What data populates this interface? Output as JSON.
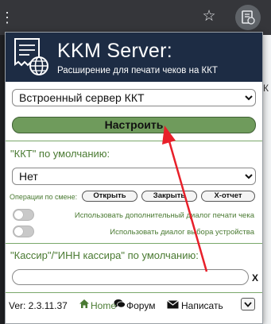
{
  "browser": {
    "bookmark_icon": "star-icon",
    "extension_icon": "kkm-extension-icon",
    "behind_text": "К"
  },
  "popup": {
    "title": "KKM Server:",
    "subtitle": "Расширение для печати чеков на ККТ",
    "server_select": {
      "selected": "Встроенный сервер ККТ"
    },
    "setup_button": "Настроить",
    "kkt_label": "\"ККТ\" по умолчанию:",
    "kkt_select": {
      "selected": "Нет"
    },
    "ops_label": "Операции по смене:",
    "ops_buttons": {
      "open": "Открыть",
      "close": "Закрыть",
      "x_report": "X-отчет"
    },
    "options": {
      "extra_dialog": "Использовать дополнительный диалог печати чека",
      "device_dialog": "Использовать диалог выбора устройства"
    },
    "cashier_label": "\"Кассир\"/\"ИНН кассира\" по умолчанию:",
    "cashier_input": {
      "value": "",
      "clear": "X"
    },
    "footer": {
      "version": "Ver: 2.3.11.37",
      "home": "Home",
      "forum": "Форум",
      "write": "Написать"
    }
  },
  "colors": {
    "header_bg": "#1d2c44",
    "accent_green": "#4a7a32",
    "button_green": "#6f9b5c",
    "annotation_red": "#e8202a"
  }
}
